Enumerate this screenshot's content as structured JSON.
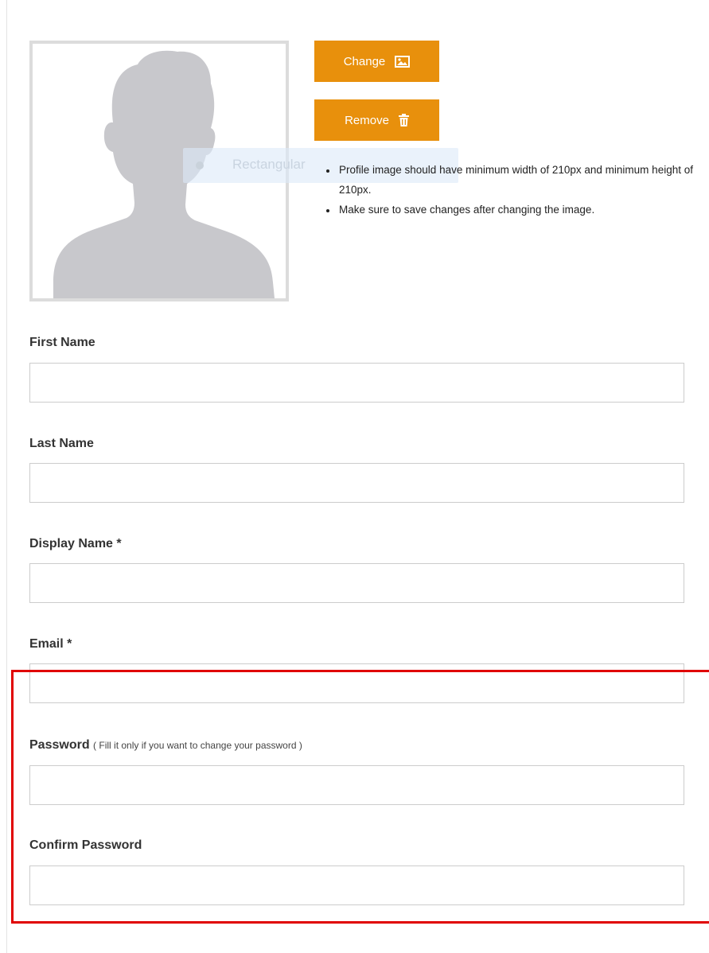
{
  "profile": {
    "change_label": "Change",
    "remove_label": "Remove",
    "notes": [
      "Profile image should have minimum width of 210px and minimum height of 210px.",
      "Make sure to save changes after changing the image."
    ],
    "overlay_text": "Rectangular"
  },
  "form": {
    "first_name": {
      "label": "First Name",
      "value": ""
    },
    "last_name": {
      "label": "Last Name",
      "value": ""
    },
    "display_name": {
      "label": "Display Name *",
      "value": ""
    },
    "email": {
      "label": "Email *",
      "value": ""
    },
    "password": {
      "label": "Password",
      "hint": "( Fill it only if you want to change your password )",
      "value": ""
    },
    "confirm_password": {
      "label": "Confirm Password",
      "value": ""
    }
  },
  "colors": {
    "accent": "#e8900c",
    "highlight": "#e00000",
    "avatar_silhouette": "#c8c8cc",
    "avatar_border": "#dcdcdc"
  },
  "icons": {
    "change": "image-icon",
    "remove": "trash-icon"
  }
}
